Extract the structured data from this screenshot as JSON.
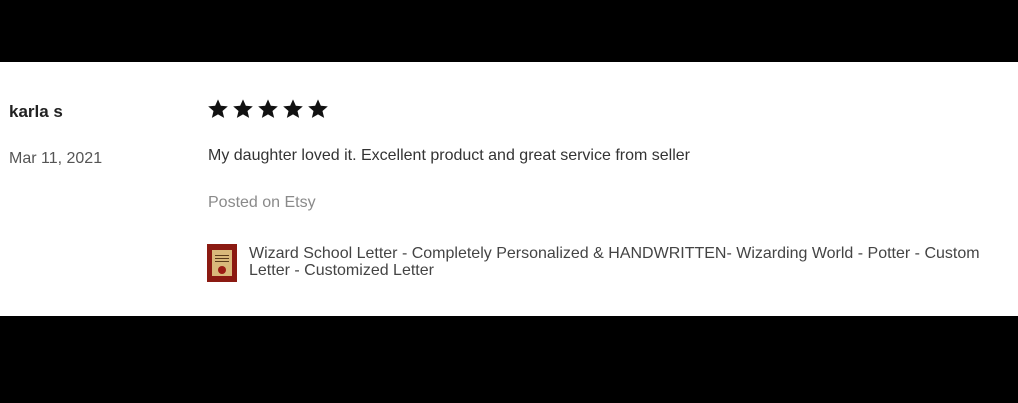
{
  "review": {
    "reviewer": "karla s",
    "date": "Mar 11, 2021",
    "rating": 5,
    "rating_max": 5,
    "text": "My daughter loved it. Excellent product and great service from seller",
    "posted_on": "Posted on Etsy"
  },
  "product": {
    "title": "Wizard School Letter - Completely Personalized & HANDWRITTEN- Wizarding World - Potter - Custom Letter - Customized Letter",
    "thumbnail_icon": "letter-thumbnail-icon"
  },
  "colors": {
    "background_band": "#000000",
    "card": "#ffffff",
    "star": "#111111"
  }
}
